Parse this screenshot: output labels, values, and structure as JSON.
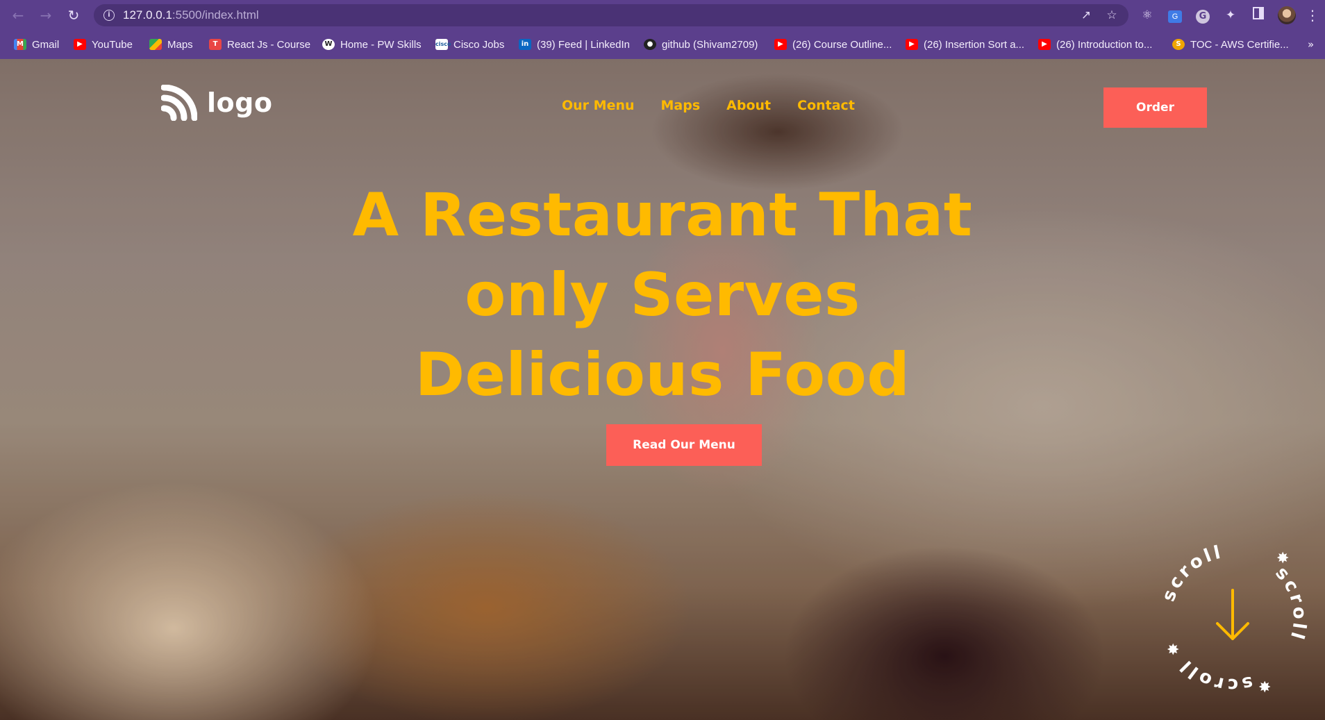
{
  "browser": {
    "url_host": "127.0.0.1",
    "url_path": ":5500/index.html",
    "bookmarks": [
      {
        "label": "Gmail",
        "icon": "gmail-icon"
      },
      {
        "label": "YouTube",
        "icon": "youtube-icon"
      },
      {
        "label": "Maps",
        "icon": "maps-icon"
      },
      {
        "label": "React Js - Course",
        "icon": "react-course-icon"
      },
      {
        "label": "Home - PW Skills",
        "icon": "pw-skills-icon"
      },
      {
        "label": "Cisco Jobs",
        "icon": "cisco-icon"
      },
      {
        "label": "(39) Feed | LinkedIn",
        "icon": "linkedin-icon"
      },
      {
        "label": "github (Shivam2709)",
        "icon": "github-icon"
      },
      {
        "label": "(26) Course Outline...",
        "icon": "youtube-icon"
      },
      {
        "label": "(26) Insertion Sort a...",
        "icon": "youtube-icon"
      },
      {
        "label": "(26) Introduction to...",
        "icon": "youtube-icon"
      },
      {
        "label": "TOC - AWS Certifie...",
        "icon": "s-icon"
      }
    ],
    "more_label": "»"
  },
  "site": {
    "logo_text": "logo",
    "nav": [
      "Our Menu",
      "Maps",
      "About",
      "Contact"
    ],
    "order_label": "Order",
    "headline": [
      "A Restaurant That",
      "only Serves",
      "Delicious Food"
    ],
    "cta_label": "Read Our Menu",
    "scroll_word": "scroll"
  },
  "colors": {
    "accent_yellow": "#ffba00",
    "button_coral": "#fc5f57",
    "chrome_purple": "#5b3f8c"
  }
}
